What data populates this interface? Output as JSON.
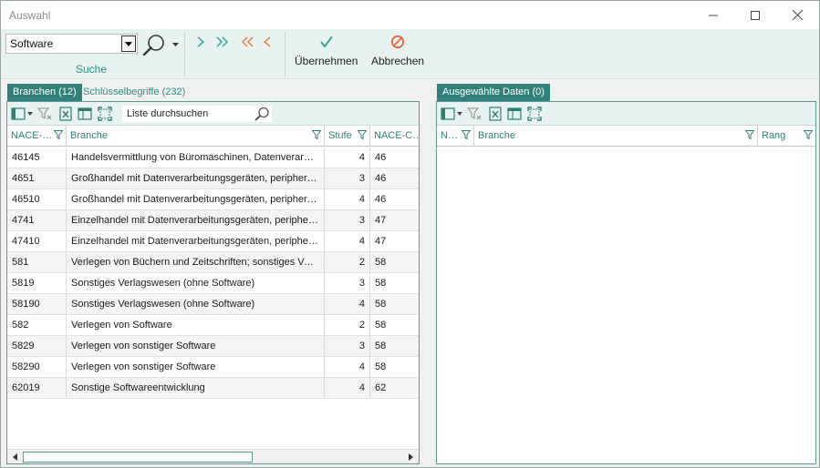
{
  "window": {
    "title": "Auswahl"
  },
  "ribbon": {
    "search_value": "Software",
    "group_label": "Suche",
    "apply_label": "Übernehmen",
    "cancel_label": "Abbrechen"
  },
  "left": {
    "tabs": [
      {
        "label": "Branchen (12)",
        "active": true
      },
      {
        "label": "Schlüsselbegriffe (232)",
        "active": false
      }
    ],
    "search_placeholder": "Liste durchsuchen",
    "columns": [
      "NACE-…",
      "Branche",
      "Stufe",
      "NACE-C…"
    ],
    "rows": [
      {
        "code": "46145",
        "branche": "Handelsvermittlung von Büromaschinen, Datenverarbeitungsgeräten",
        "stufe": "4",
        "nace": "46"
      },
      {
        "code": "4651",
        "branche": "Großhandel mit Datenverarbeitungsgeräten, peripheren Geräten",
        "stufe": "3",
        "nace": "46"
      },
      {
        "code": "46510",
        "branche": "Großhandel mit Datenverarbeitungsgeräten, peripheren Geräten",
        "stufe": "4",
        "nace": "46"
      },
      {
        "code": "4741",
        "branche": "Einzelhandel mit Datenverarbeitungsgeräten, peripheren Geräten",
        "stufe": "3",
        "nace": "47"
      },
      {
        "code": "47410",
        "branche": "Einzelhandel mit Datenverarbeitungsgeräten, peripheren Geräten",
        "stufe": "4",
        "nace": "47"
      },
      {
        "code": "581",
        "branche": "Verlegen von Büchern und Zeitschriften; sonstiges Verlagswesen",
        "stufe": "2",
        "nace": "58"
      },
      {
        "code": "5819",
        "branche": "Sonstiges Verlagswesen (ohne Software)",
        "stufe": "3",
        "nace": "58"
      },
      {
        "code": "58190",
        "branche": "Sonstiges Verlagswesen (ohne Software)",
        "stufe": "4",
        "nace": "58"
      },
      {
        "code": "582",
        "branche": "Verlegen von Software",
        "stufe": "2",
        "nace": "58"
      },
      {
        "code": "5829",
        "branche": "Verlegen von sonstiger Software",
        "stufe": "3",
        "nace": "58"
      },
      {
        "code": "58290",
        "branche": "Verlegen von sonstiger Software",
        "stufe": "4",
        "nace": "58"
      },
      {
        "code": "62019",
        "branche": "Sonstige Softwareentwicklung",
        "stufe": "4",
        "nace": "62"
      }
    ]
  },
  "right": {
    "tabs": [
      {
        "label": "Ausgewählte Daten (0)",
        "active": true
      }
    ],
    "columns": [
      "N…",
      "Branche",
      "Rang"
    ]
  },
  "colors": {
    "accent": "#31807a",
    "ribbon_bg": "#e6f3f1",
    "nav_teal": "#3aa59a",
    "nav_orange": "#e87d4a",
    "cancel": "#e8623a"
  }
}
